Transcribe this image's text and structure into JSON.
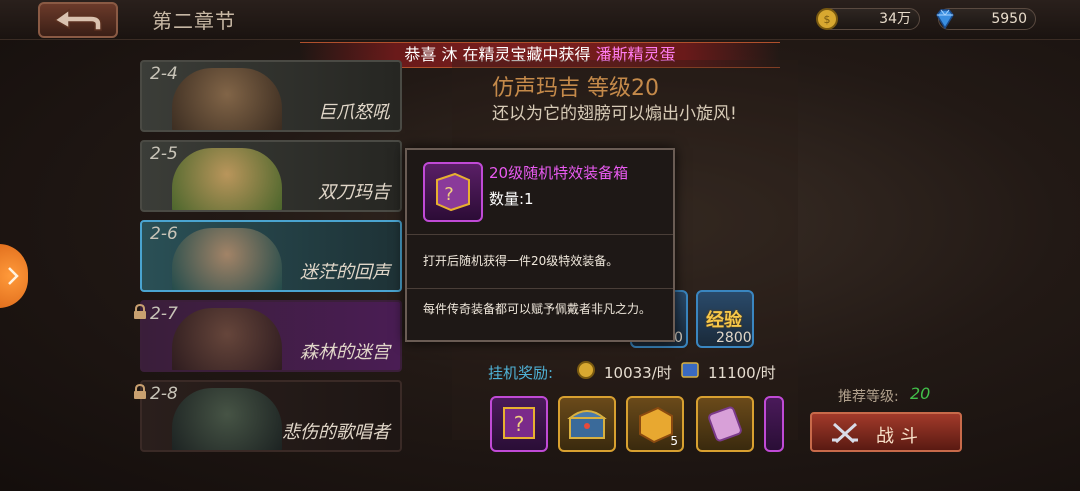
{
  "header": {
    "chapter_title": "第二章节",
    "coins": "34万",
    "gems": "5950"
  },
  "notice": {
    "part1": "恭喜",
    "player": "沐",
    "part2": "在精灵宝藏中获得",
    "item": "潘斯精灵蛋"
  },
  "stages": [
    {
      "num": "2-4",
      "name": "巨爪怒吼"
    },
    {
      "num": "2-5",
      "name": "双刀玛吉"
    },
    {
      "num": "2-6",
      "name": "迷茫的回声"
    },
    {
      "num": "2-7",
      "name": "森林的迷宫"
    },
    {
      "num": "2-8",
      "name": "悲伤的歌唱者"
    }
  ],
  "monster": {
    "title": "仿声玛吉  等级20",
    "desc": "还以为它的翅膀可以煽出小旋风!"
  },
  "rewards": {
    "partial_value": "0",
    "exp_label": "经验",
    "exp_value": "2800",
    "idle_label": "挂机奖励:",
    "idle_coin": "10033/时",
    "idle_exp": "11100/时",
    "item_count": "5"
  },
  "battle": {
    "rec_label": "推荐等级:",
    "rec_value": "20",
    "button": "战斗"
  },
  "popup": {
    "title": "20级随机特效装备箱",
    "quantity": "数量:1",
    "line1": "打开后随机获得一件20级特效装备。",
    "line2": "每件传奇装备都可以赋予佩戴者非凡之力。"
  },
  "colors": {
    "accent_purple": "#e85af0",
    "notice_item": "#ff7cf0",
    "idle_label": "#4fb2d6",
    "rec_value": "#42c04a"
  }
}
